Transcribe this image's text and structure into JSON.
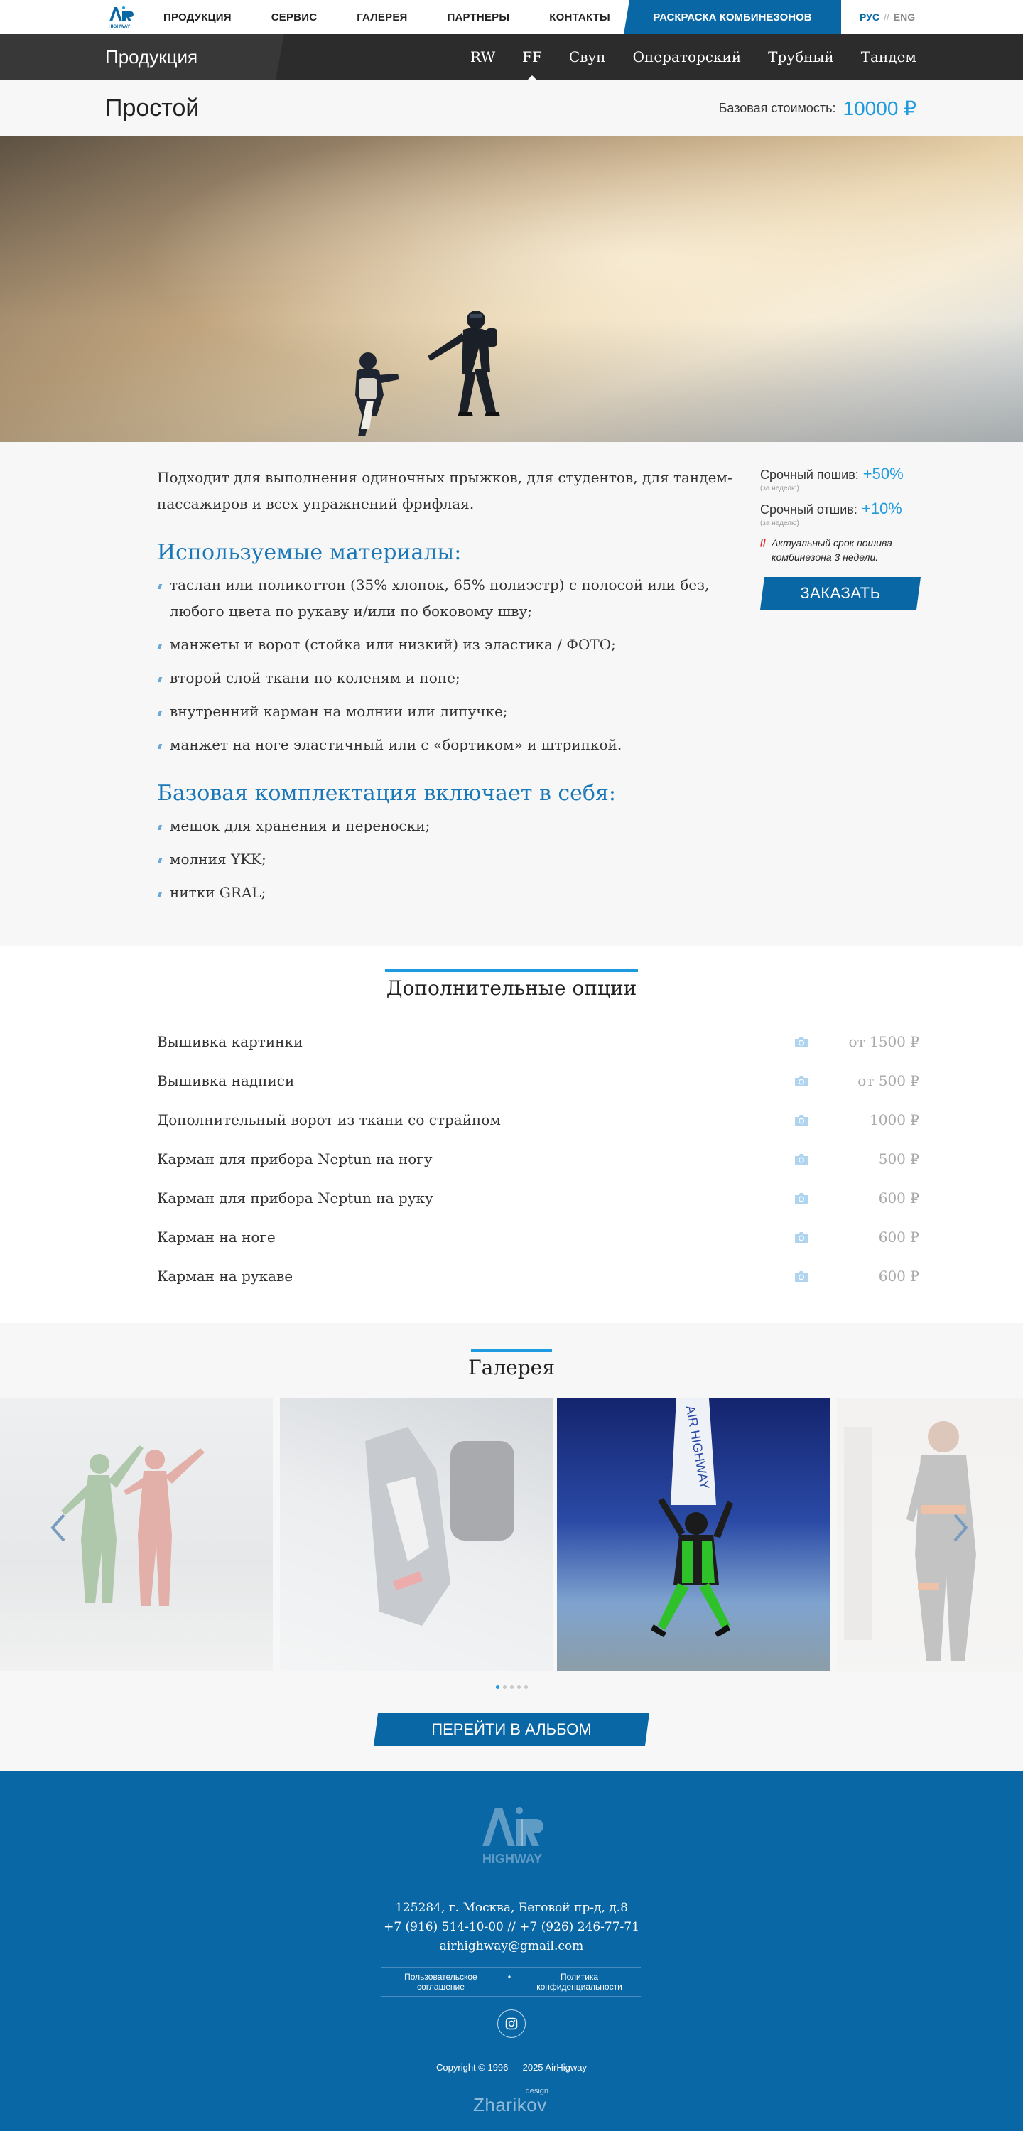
{
  "nav": {
    "items": [
      "ПРОДУКЦИЯ",
      "СЕРВИС",
      "ГАЛЕРЕЯ",
      "ПАРТНЕРЫ",
      "КОНТАКТЫ"
    ],
    "paint_label": "РАСКРАСКА КОМБИНЕЗОНОВ",
    "lang_active": "РУС",
    "lang_sep": "//",
    "lang_other": "ENG",
    "logo_text": "HIGHWAY"
  },
  "products_bar": {
    "title": "Продукция",
    "tabs": [
      "RW",
      "FF",
      "Свуп",
      "Операторский",
      "Трубный",
      "Тандем"
    ],
    "active_tab": "FF"
  },
  "product": {
    "name": "Простой",
    "price_label": "Базовая стоимость:",
    "price_value": "10000 ₽"
  },
  "description": {
    "intro": "Подходит для выполнения одиночных прыжков, для студентов, для тандем-пассажиров и всех упражнений фрифлая.",
    "materials_heading": "Используемые материалы:",
    "materials": [
      "таслан или поликоттон (35% хлопок, 65% полиэстр) с полосой или без, любого цвета по рукаву и/или по боковому шву;",
      "манжеты и ворот (стойка или низкий) из эластика / ФОТО;",
      "второй слой ткани по коленям и попе;",
      "внутренний карман на молнии или липучке;",
      "манжет на ноге  эластичный  или с «бортиком» и штрипкой."
    ],
    "kit_heading": "Базовая комплектация включает в себя:",
    "kit": [
      "мешок для хранения и переноски;",
      "молния YKK;",
      "нитки GRAL;"
    ]
  },
  "sidebar": {
    "urgent_sew_label": "Срочный пошив:",
    "urgent_sew_value": "+50%",
    "urgent_sew_note": "(за неделю)",
    "urgent_ship_label": "Срочный отшив:",
    "urgent_ship_value": "+10%",
    "urgent_ship_note": "(за неделю)",
    "notice_mark": "//",
    "notice": "Актуальный срок пошива комбинезона 3 недели.",
    "order_label": "ЗАКАЗАТЬ"
  },
  "options": {
    "heading": "Дополнительные опции",
    "items": [
      {
        "name": "Вышивка картинки",
        "price": "от 1500 ₽"
      },
      {
        "name": "Вышивка надписи",
        "price": "от 500 ₽"
      },
      {
        "name": "Дополнительный ворот из ткани со страйпом",
        "price": "1000 ₽"
      },
      {
        "name": "Карман для прибора Neptun на ногу",
        "price": "500 ₽"
      },
      {
        "name": "Карман для прибора Neptun на руку",
        "price": "600 ₽"
      },
      {
        "name": "Карман на ноге",
        "price": "600 ₽"
      },
      {
        "name": "Карман на рукаве",
        "price": "600 ₽"
      }
    ],
    "icon": "camera-icon"
  },
  "gallery": {
    "heading": "Галерея",
    "slides_count": 4,
    "dots": 5,
    "active_dot": 0,
    "album_label": "ПЕРЕЙТИ В АЛЬБОМ",
    "banner_text": "AIR HIGHWAY"
  },
  "footer": {
    "logo_text": "HIGHWAY",
    "address": "125284, г. Москва, Беговой пр-д, д.8",
    "phones": "+7 (916) 514-10-00 // +7 (926) 246-77-71",
    "email": "airhighway@gmail.com",
    "link_terms": "Пользовательское соглашение",
    "link_bullet": "•",
    "link_privacy": "Политика конфиденциальности",
    "copyright": "Copyright © 1996 — 2025 AirHigway",
    "design_label": "design",
    "designer": "Zharikov"
  },
  "colors": {
    "brand_blue": "#0a67a6",
    "accent_blue": "#1e9be0",
    "heading_blue": "#1b78b8",
    "dark_bar": "#2c2c2c",
    "light_bg": "#f7f7f7"
  }
}
